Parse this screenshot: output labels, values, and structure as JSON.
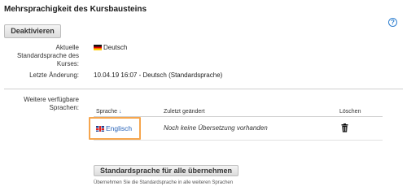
{
  "section": {
    "title": "Mehrsprachigkeit des Kursbausteins",
    "help_icon": "question-circle-icon",
    "help_glyph": "?"
  },
  "actions": {
    "deactivate_label": "Deaktivieren"
  },
  "current_language": {
    "label_line1": "Aktuelle",
    "label_line2": "Standardsprache des",
    "label_line3": "Kurses:",
    "value": "Deutsch",
    "flag_icon": "german-flag-icon"
  },
  "last_change": {
    "label": "Letzte Änderung:",
    "value": "10.04.19 16:07 - Deutsch (Standardsprache)"
  },
  "other_languages": {
    "label_line1": "Weitere verfügbare",
    "label_line2": "Sprachen:",
    "headers": {
      "language": "Sprache",
      "sort_arrow": "↓",
      "last_changed": "Zuletzt geändert",
      "delete": "Löschen"
    },
    "rows": [
      {
        "language": "Englisch",
        "flag_icon": "british-flag-icon",
        "last_changed": "Noch keine Übersetzung vorhanden",
        "delete_icon": "trash-icon"
      }
    ]
  },
  "apply_all": {
    "button_label": "Standardsprache für alle übernehmen",
    "hint": "Übernehmen Sie die Standardsprache in alle weiteren Sprachen"
  },
  "colors": {
    "link": "#2a64b8",
    "highlight": "#f6a64e",
    "help": "#2f7fcf"
  }
}
